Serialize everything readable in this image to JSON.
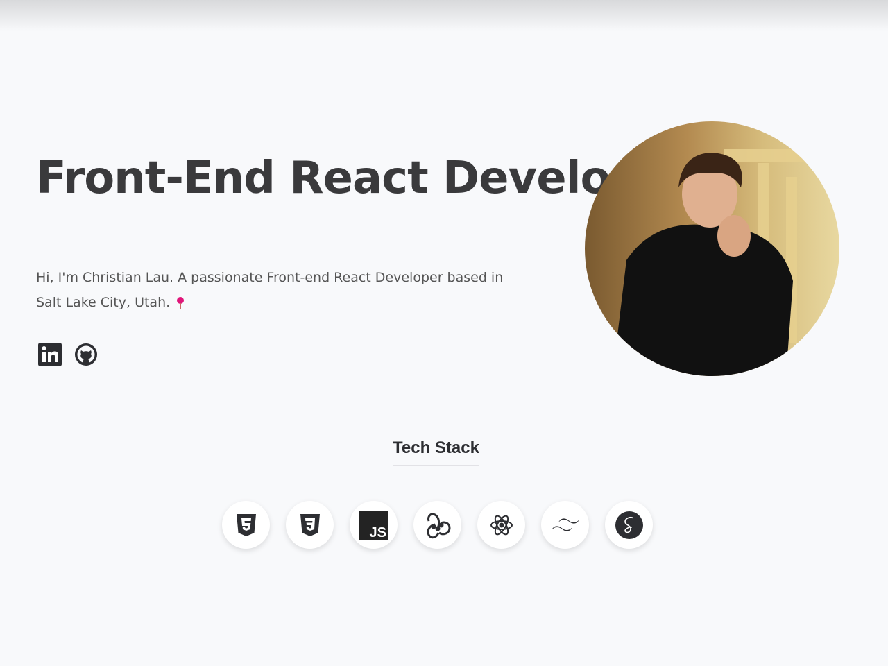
{
  "hero": {
    "title": "Front-End React Developer",
    "intro": "Hi, I'm Christian Lau. A passionate Front-end React Developer based in Salt Lake City, Utah.",
    "photo_alt": "Christian Lau"
  },
  "social": [
    {
      "icon": "linkedin-icon"
    },
    {
      "icon": "github-icon"
    }
  ],
  "tech": {
    "heading": "Tech Stack",
    "items": [
      "html5-icon",
      "css3-icon",
      "javascript-icon",
      "redux-icon",
      "react-icon",
      "tailwind-icon",
      "sass-icon"
    ]
  },
  "colors": {
    "text": "#3a3a3c",
    "pin": "#e0157a",
    "bg": "#f8f9fb"
  }
}
